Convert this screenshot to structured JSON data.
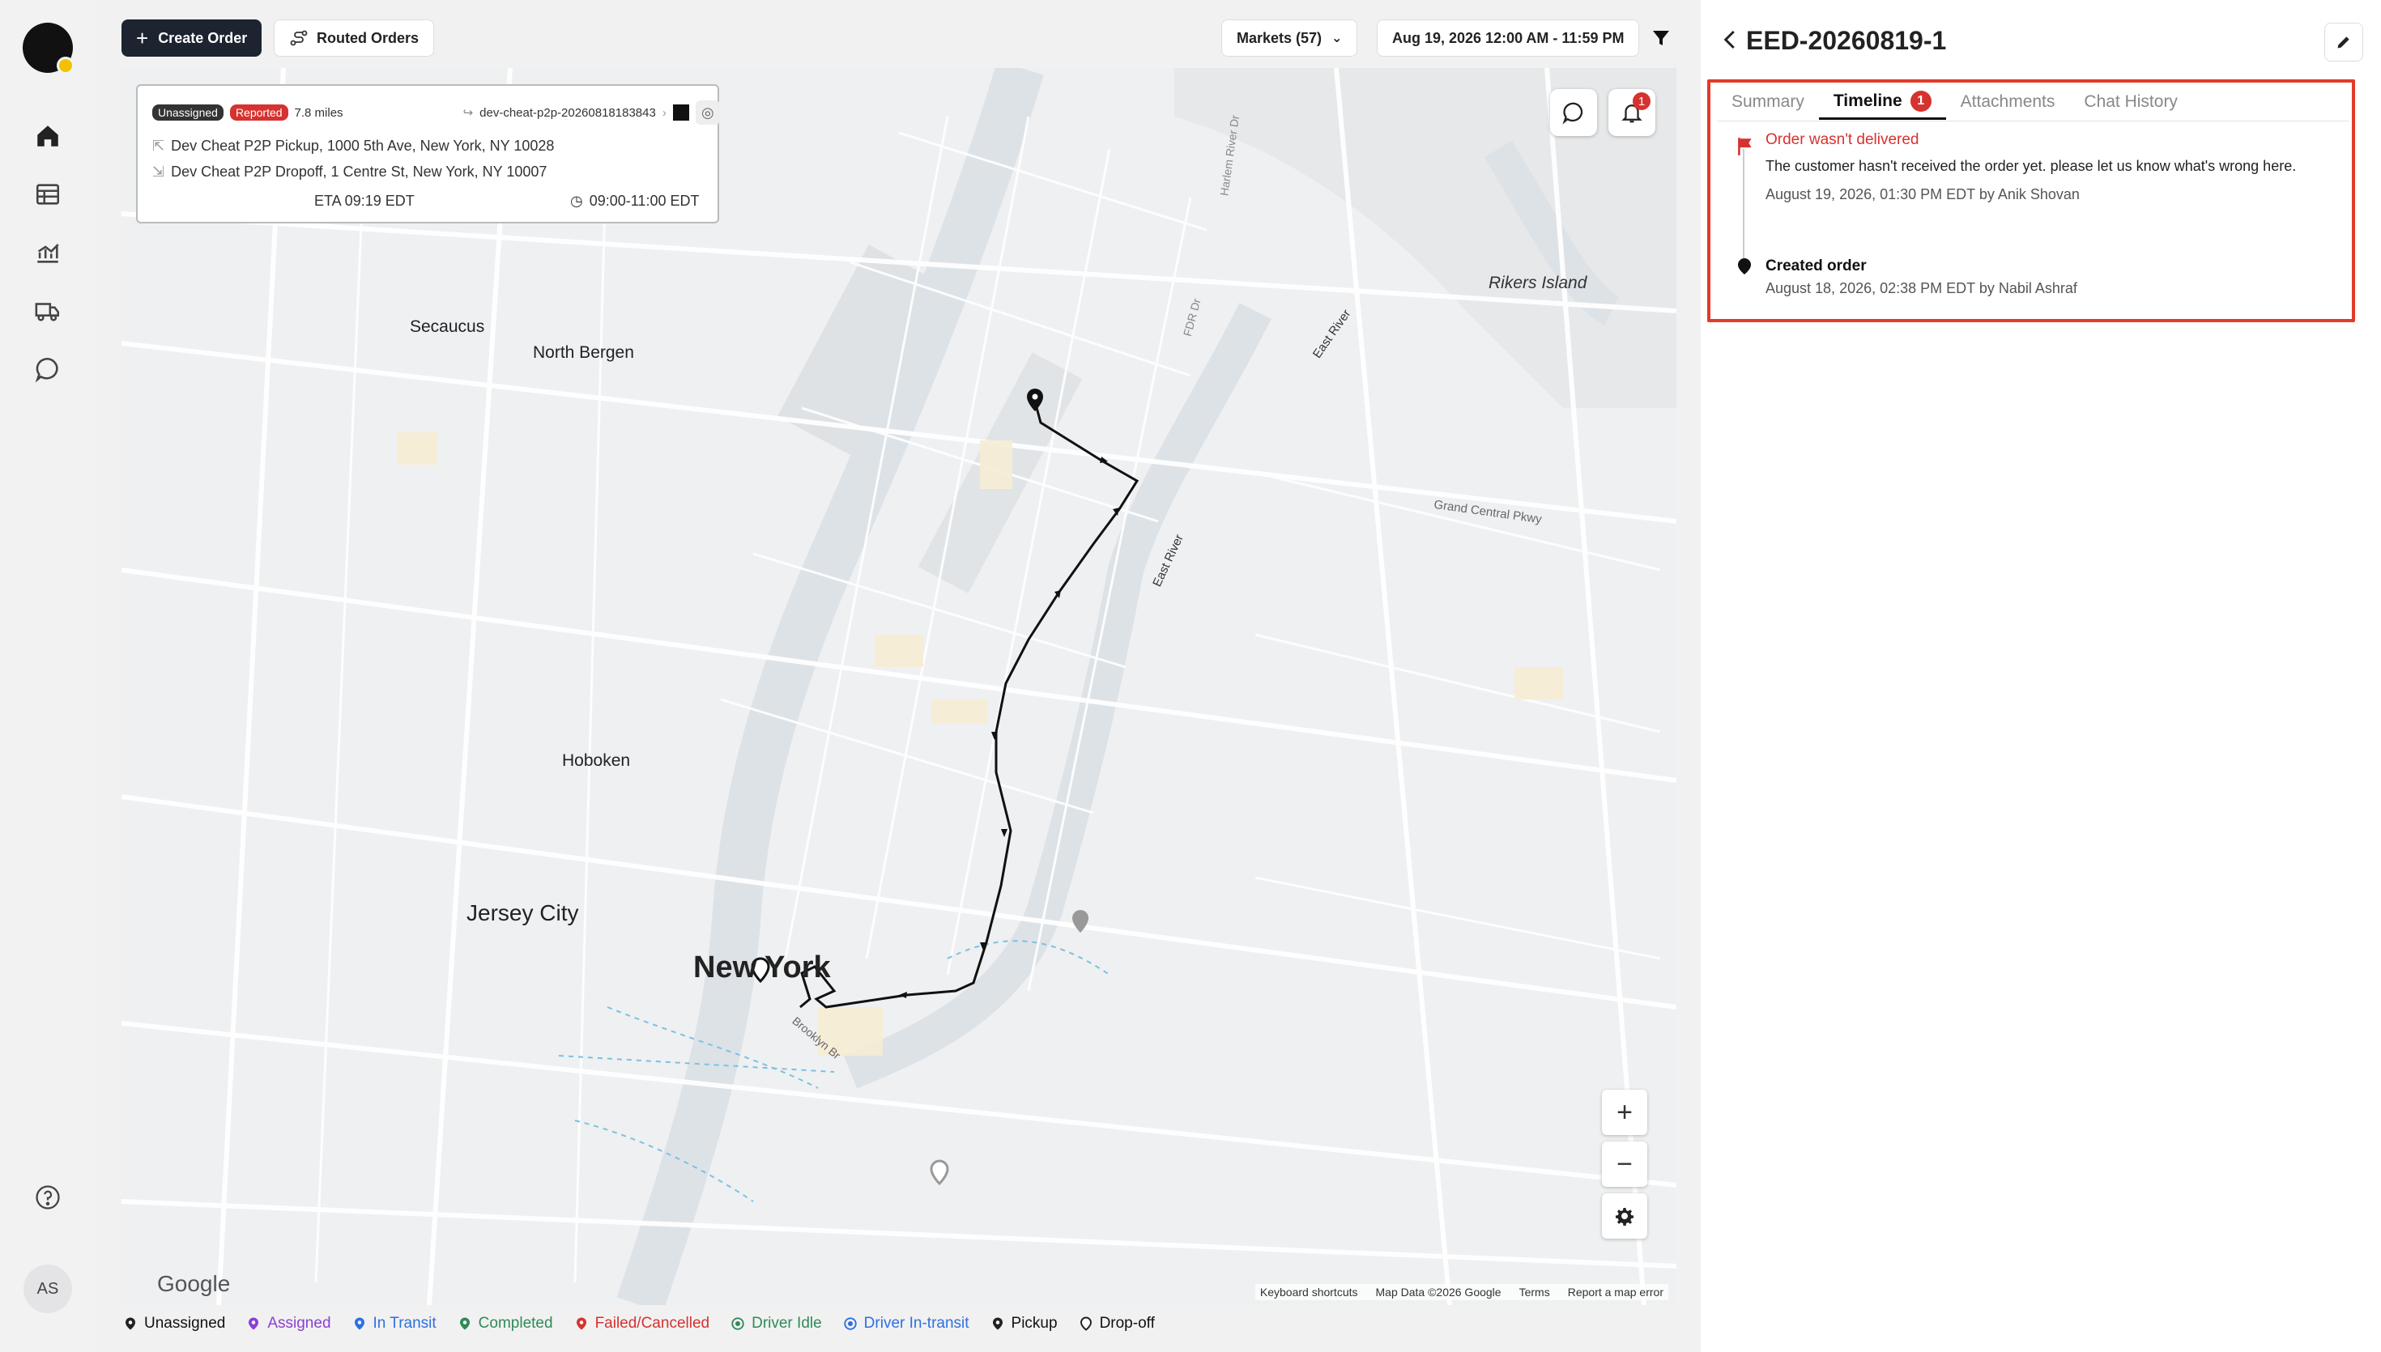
{
  "toolbar": {
    "create_label": "Create Order",
    "routed_label": "Routed Orders",
    "markets_label": "Markets (57)",
    "date_range": "Aug 19, 2026 12:00 AM - 11:59 PM"
  },
  "order_card": {
    "status_unassigned": "Unassigned",
    "status_reported": "Reported",
    "distance": "7.8 miles",
    "order_ref": "dev-cheat-p2p-20260818183843",
    "pickup": "Dev Cheat P2P Pickup, 1000 5th Ave, New York, NY 10028",
    "dropoff": "Dev Cheat P2P Dropoff, 1 Centre St, New York, NY 10007",
    "eta": "ETA 09:19 EDT",
    "window": "09:00-11:00 EDT"
  },
  "map": {
    "notification_count": "1",
    "labels": {
      "secaucus": "Secaucus",
      "north_bergen": "North Bergen",
      "hoboken": "Hoboken",
      "jersey_city": "Jersey City",
      "new_york": "New York",
      "rikers": "Rikers Island",
      "east_river": "East River",
      "east_river2": "East River",
      "fdr": "FDR Dr",
      "grand_central": "Grand Central Pkwy",
      "brooklyn_br": "Brooklyn Br",
      "harlem_river": "Harlem River Dr"
    },
    "google_logo": "Google",
    "footer": {
      "shortcuts": "Keyboard shortcuts",
      "map_data": "Map Data ©2026 Google",
      "terms": "Terms",
      "report": "Report a map error"
    },
    "zoom_in": "+",
    "zoom_out": "−"
  },
  "legend": [
    {
      "label": "Unassigned",
      "color": "#222222"
    },
    {
      "label": "Assigned",
      "color": "#8b3fd1"
    },
    {
      "label": "In Transit",
      "color": "#2f6fe0"
    },
    {
      "label": "Completed",
      "color": "#2e8b57"
    },
    {
      "label": "Failed/Cancelled",
      "color": "#d6322f"
    },
    {
      "label": "Driver Idle",
      "color": "#2e8b57"
    },
    {
      "label": "Driver In-transit",
      "color": "#2f6fe0"
    },
    {
      "label": "Pickup",
      "color": "#222222"
    },
    {
      "label": "Drop-off",
      "color": "#222222"
    }
  ],
  "user": {
    "initials": "AS"
  },
  "panel": {
    "title": "EED-20260819-1",
    "tabs": [
      {
        "label": "Summary"
      },
      {
        "label": "Timeline",
        "badge": "1"
      },
      {
        "label": "Attachments"
      },
      {
        "label": "Chat History"
      }
    ],
    "timeline": [
      {
        "title": "Order wasn't delivered",
        "body": "The customer hasn't received the order yet. please let us know what's wrong here.",
        "meta": "August 19, 2026, 01:30 PM EDT by Anik Shovan"
      },
      {
        "title": "Created order",
        "meta": "August 18, 2026, 02:38 PM EDT by Nabil Ashraf"
      }
    ]
  }
}
